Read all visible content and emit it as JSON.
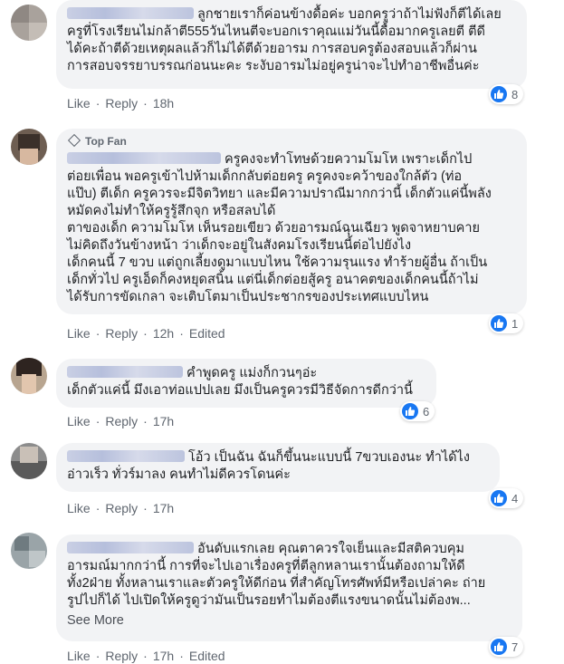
{
  "actions": {
    "like": "Like",
    "reply": "Reply",
    "edited": "Edited",
    "see_more": "See More"
  },
  "badge": {
    "top_fan": "Top Fan"
  },
  "colors": {
    "accent": "#1877f2",
    "bubble": "#f2f3f5",
    "meta": "#606770"
  },
  "icons": {
    "reaction": "like-thumb-icon",
    "badge": "diamond-icon"
  },
  "comments": [
    {
      "text": "ลูกชายเราก็ค่อนข้างดื้อค่ะ บอกครูว่าถ้าไม่ฟังก็ตีได้เลย\nครูที่โรงเรียนไม่กล้าตี555วันไหนตีจะบอกเราคุณแม่วันนี้ดื้อมากครูเลยตี ตีดี\nได้คะถ้าตีด้วยเหตุผลแล้วก็ไม่ได้ตีด้วยอารม การสอบครูต้องสอบแล้วก็ผ่าน\nการสอบจรรยาบรรณก่อนนะคะ ระงับอารมไม่อยู่ครูน่าจะไปทำอาชีพอื่นค่ะ",
      "time": "18h",
      "reactions": "8"
    },
    {
      "text": "ครูคงจะทำโทษด้วยความโมโห เพราะเด็กไป\nต่อยเพื่อน พอครูเข้าไปห้ามเด็กกลับต่อยครู ครูคงจะคว้าของใกล้ตัว (ท่อ\nแป๊บ) ตีเด็ก ครูควรจะมีจิตวิทยา และมีความปราณีมากกว่านี้ เด็กตัวแค่นี้พลัง\nหมัดคงไม่ทำให้ครูรู้สึกจุก หรือสลบได้\nตาของเด็ก ความโมโห เห็นรอยเขียว ด้วยอารมณ์ฉุนเฉียว พูดจาหยาบคาย\nไม่คิดถึงวันข้างหน้า ว่าเด็กจะอยู่ในสังคมโรงเรียนนี้ต่อไปยังไง\nเด็กคนนี้ 7 ขวบ แต่ถูกเลี้ยงดูมาแบบไหน ใช้ความรุนแรง ทำร้ายผู้อื่น ถ้าเป็น\nเด็กทั่วไป ครูเอ็ดก็คงหยุดสนิ้น แต่นี่เด็กต่อยสู้ครู อนาคตของเด็กคนนี้ถ้าไม่\nได้รับการขัดเกลา จะเติบโตมาเป็นประชากรของประเทศแบบไหน",
      "time": "12h",
      "reactions": "1"
    },
    {
      "text": "คำพูดครู แม่งก็กวนๆอ่ะ\nเด็กตัวแค่นี้ มึงเอาท่อแปปเลย มึงเป็นครูควรมีวิธีจัดการดีกว่านี้",
      "time": "17h",
      "reactions": "6"
    },
    {
      "text": "โอ้ว เป็นฉัน ฉันก็ขึ้นนะแบบนี้ 7ขวบเองนะ ทำได้ไง\nอ่าวเร็ว ทั่วร์มาลง คนทำไม่ดีควรโดนค่ะ",
      "time": "17h",
      "reactions": "4"
    },
    {
      "text": "อันดับแรกเลย คุณตาควรใจเย็นและมีสติควบคุม\nอารมณ์มากกว่านี้ การที่จะไปเอาเรื่องครูที่ตีลูกหลานเรานั้นต้องถามให้ดี\nทั้ง2ฝ่าย ทั้งหลานเราและตัวครูให้ดีก่อน ที่สำคัญโทรศัพท์มีหรือเปล่าคะ ถ่าย\nรูปไปก็ได้ ไปเปิดให้ครูดูว่ามันเป็นรอยทำไมต้องตีแรงขนาดนั้นไม่ต้องพ...",
      "time": "17h",
      "reactions": "7"
    }
  ]
}
